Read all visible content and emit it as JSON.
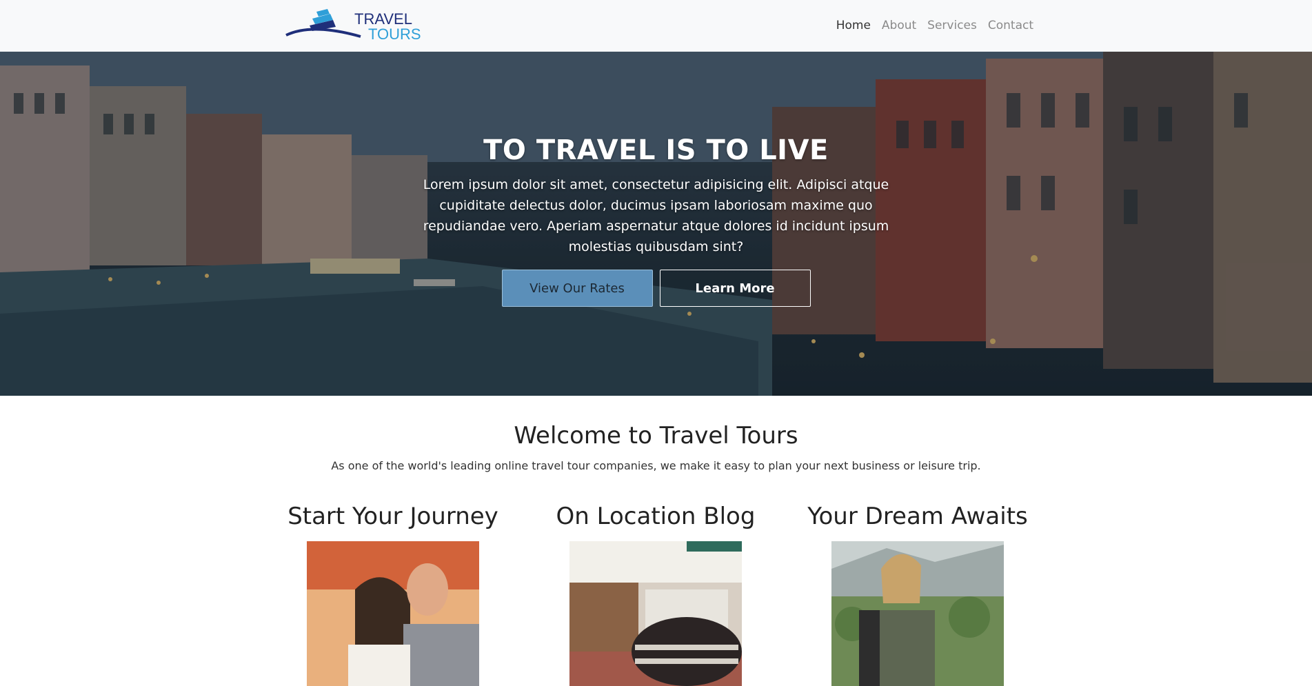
{
  "brand": {
    "name_line1": "TRAVEL",
    "name_line2": "TOURS",
    "colors": {
      "dark_blue": "#1f2f7a",
      "light_blue": "#2f9fd8"
    }
  },
  "nav": {
    "items": [
      {
        "label": "Home",
        "active": true
      },
      {
        "label": "About",
        "active": false
      },
      {
        "label": "Services",
        "active": false
      },
      {
        "label": "Contact",
        "active": false
      }
    ]
  },
  "hero": {
    "title": "TO TRAVEL IS TO LIVE",
    "text": "Lorem ipsum dolor sit amet, consectetur adipisicing elit. Adipisci atque cupiditate delectus dolor, ducimus ipsam laboriosam maxime quo repudiandae vero. Aperiam aspernatur atque dolores id incidunt ipsum molestias quibusdam sint?",
    "primary_button": "View Our Rates",
    "secondary_button": "Learn More",
    "background": "venice-canal-photo"
  },
  "welcome": {
    "title": "Welcome to Travel Tours",
    "subtitle": "As one of the world's leading online travel tour companies, we make it easy to plan your next business or leisure trip."
  },
  "features": [
    {
      "title": "Start Your Journey",
      "image": "couple-photo"
    },
    {
      "title": "On Location Blog",
      "image": "hotel-lobby-photo"
    },
    {
      "title": "Your Dream Awaits",
      "image": "hiker-woman-photo"
    }
  ],
  "colors": {
    "navbar_bg": "#f8f9fa",
    "primary_button_bg": "#5b8fb9",
    "nav_active": "#333333",
    "nav_inactive": "#8a8a8a"
  }
}
